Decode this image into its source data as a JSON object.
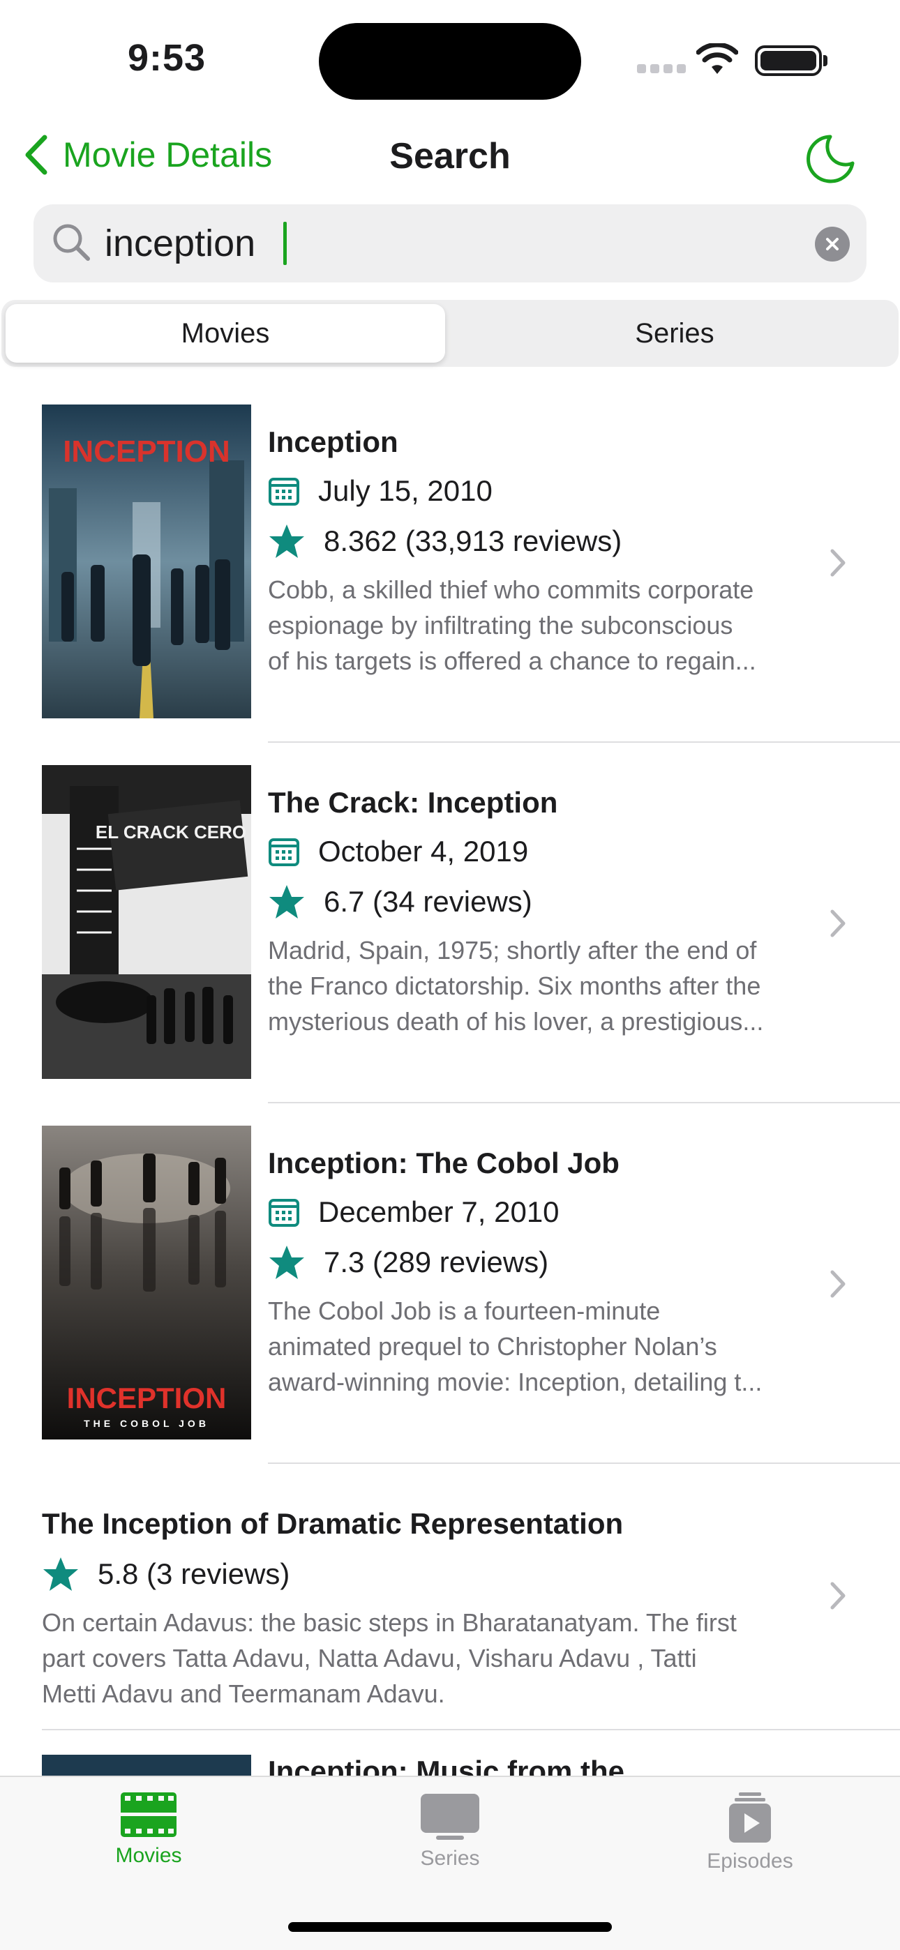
{
  "status_bar": {
    "time": "9:53"
  },
  "nav": {
    "back_label": "Movie Details",
    "title": "Search"
  },
  "search": {
    "value": "inception",
    "placeholder": ""
  },
  "segments": [
    {
      "label": "Movies",
      "selected": true
    },
    {
      "label": "Series",
      "selected": false
    }
  ],
  "results": [
    {
      "title": "Inception",
      "date": "July 15, 2010",
      "rating": "8.362 (33,913 reviews)",
      "description": [
        "Cobb, a skilled thief who commits corporate",
        "espionage by infiltrating the subconscious",
        "of his targets is offered a chance to regain..."
      ],
      "poster_text": "INCEPTION"
    },
    {
      "title": "The Crack: Inception",
      "date": "October 4, 2019",
      "rating": "6.7 (34 reviews)",
      "description": [
        "Madrid, Spain, 1975; shortly after the end of",
        "the Franco dictatorship. Six months after the",
        "mysterious death of his lover, a prestigious..."
      ],
      "poster_text": "EL CRACK CERO"
    },
    {
      "title": "Inception: The Cobol Job",
      "date": "December 7, 2010",
      "rating": "7.3 (289 reviews)",
      "description": [
        "The Cobol Job is a fourteen-minute",
        "animated prequel to Christopher Nolan’s",
        "award-winning movie: Inception, detailing t..."
      ],
      "poster_text": "INCEPTION",
      "poster_subtext": "THE COBOL JOB"
    },
    {
      "title": "The Inception of Dramatic Representation",
      "rating": "5.8 (3 reviews)",
      "description": [
        "On certain Adavus: the basic steps in Bharatanatyam. The first",
        "part covers Tatta Adavu, Natta Adavu, Visharu Adavu , Tatti",
        "Metti Adavu and Teermanam Adavu."
      ]
    },
    {
      "title": "Inception: Music from the"
    }
  ],
  "tabs": [
    {
      "label": "Movies",
      "icon": "film-icon",
      "active": true
    },
    {
      "label": "Series",
      "icon": "tv-icon",
      "active": false
    },
    {
      "label": "Episodes",
      "icon": "episodes-icon",
      "active": false
    }
  ],
  "colors": {
    "accent": "#1aa41f",
    "star": "#0f8b7e",
    "inactive_tab": "#9a9a9e",
    "secondary_text": "#6e6e73"
  }
}
